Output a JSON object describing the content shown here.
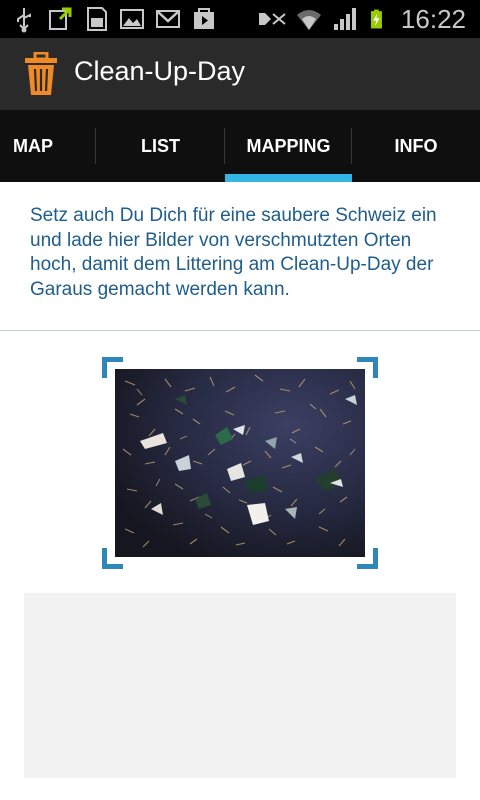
{
  "status_bar": {
    "time": "16:22",
    "icons_left": [
      "usb-icon",
      "download-icon",
      "sd-card-icon",
      "gallery-icon",
      "gmail-icon",
      "play-store-icon"
    ],
    "icons_right": [
      "mute-icon",
      "wifi-icon",
      "signal-icon",
      "battery-icon"
    ],
    "battery_color": "#99cc00"
  },
  "action_bar": {
    "title": "Clean-Up-Day",
    "icon": "trash-can-icon",
    "icon_color": "#f08a24"
  },
  "tabs": [
    {
      "label": "MAP",
      "selected": false
    },
    {
      "label": "LIST",
      "selected": false
    },
    {
      "label": "MAPPING",
      "selected": true
    },
    {
      "label": "INFO",
      "selected": false
    }
  ],
  "content": {
    "intro_text": "Setz auch Du Dich für eine saubere Schweiz ein und lade hier Bilder von verschmutzten Orten hoch, damit dem Littering am Clean-Up-Day der Garaus gemacht werden kann."
  },
  "colors": {
    "accent": "#33b5e5",
    "text": "#1f5d8c",
    "frame": "#2f86b8"
  }
}
